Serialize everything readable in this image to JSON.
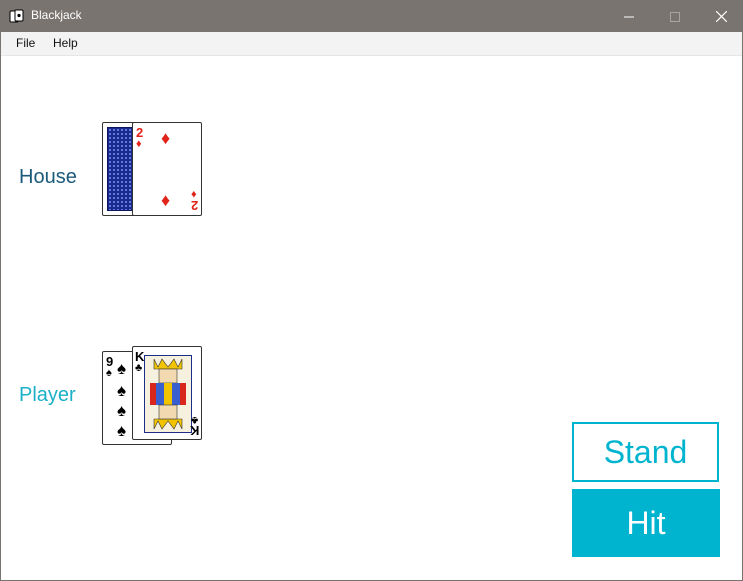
{
  "window": {
    "title": "Blackjack"
  },
  "menu": {
    "items": [
      "File",
      "Help"
    ]
  },
  "house": {
    "label": "House",
    "label_color": "#1b5a7a",
    "cards": [
      {
        "face_down": true
      },
      {
        "rank": "2",
        "suit": "diamonds",
        "suit_symbol": "♦",
        "color": "#e2231a"
      }
    ]
  },
  "player": {
    "label": "Player",
    "label_color": "#1ab0c8",
    "cards": [
      {
        "rank": "9",
        "suit": "spades",
        "suit_symbol": "♠",
        "color": "#000000"
      },
      {
        "rank": "K",
        "suit": "clubs",
        "suit_symbol": "♣",
        "color": "#000000"
      }
    ]
  },
  "actions": {
    "stand_label": "Stand",
    "hit_label": "Hit",
    "accent": "#00b4cf"
  }
}
